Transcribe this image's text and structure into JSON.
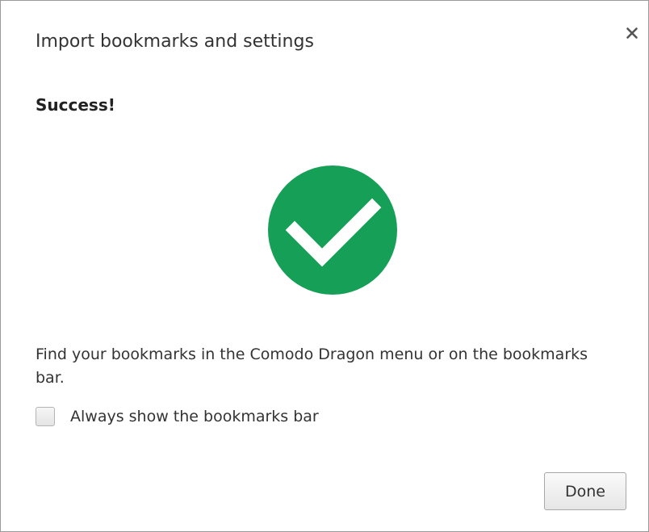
{
  "dialog": {
    "title": "Import bookmarks and settings",
    "close_icon": "close-icon",
    "heading": "Success!",
    "status_icon": "check-circle-icon",
    "message": "Find your bookmarks in the Comodo Dragon menu or on the bookmarks bar.",
    "checkbox": {
      "label": "Always show the bookmarks bar",
      "checked": false
    },
    "done_label": "Done"
  },
  "colors": {
    "success_green": "#169f57",
    "check_white": "#ffffff",
    "text": "#333333",
    "border": "#9a9a9a"
  }
}
